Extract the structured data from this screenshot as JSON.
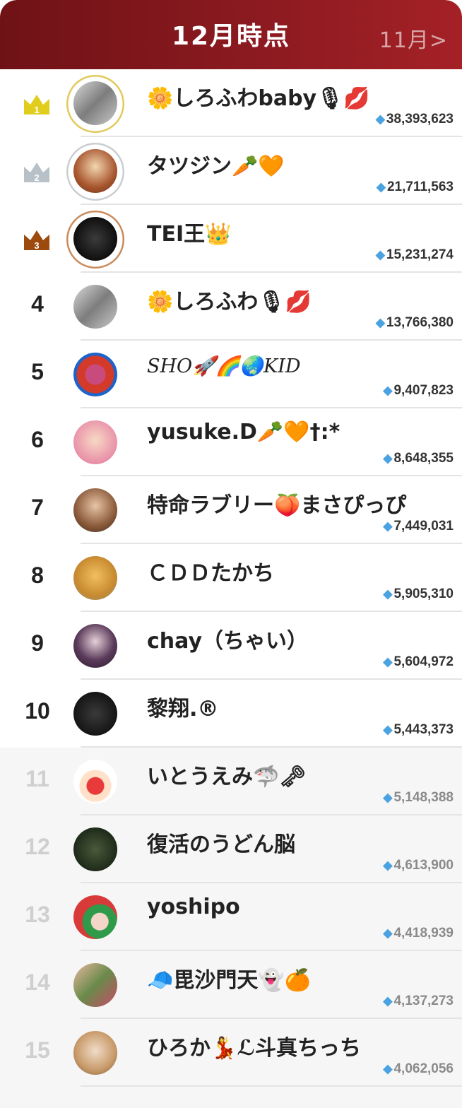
{
  "header": {
    "title": "12月時点",
    "next_month": "11月>"
  },
  "colors": {
    "header_start": "#6f1216",
    "header_end": "#a42126",
    "gold": "#e0cd1c",
    "silver": "#b8c0c8",
    "bronze": "#9c4a0e",
    "gem": "#4aa3e0"
  },
  "entries": [
    {
      "rank": "1",
      "name": "🌼しろふわbaby🎙💋",
      "score": "38,393,623",
      "crown": "gold"
    },
    {
      "rank": "2",
      "name": "タツジン🥕🧡",
      "score": "21,711,563",
      "crown": "silver"
    },
    {
      "rank": "3",
      "name": "TEI王👑",
      "score": "15,231,274",
      "crown": "bronze"
    },
    {
      "rank": "4",
      "name": "🌼しろふわ🎙💋",
      "score": "13,766,380"
    },
    {
      "rank": "5",
      "name": "SHO🚀🌈🌏KID",
      "score": "9,407,823"
    },
    {
      "rank": "6",
      "name": "yusuke.D🥕🧡†:*",
      "score": "8,648,355"
    },
    {
      "rank": "7",
      "name": "特命ラブリー🍑まさぴっぴ",
      "score": "7,449,031"
    },
    {
      "rank": "8",
      "name": "ＣＤＤたかち",
      "score": "5,905,310"
    },
    {
      "rank": "9",
      "name": "chay（ちゃい）",
      "score": "5,604,972"
    },
    {
      "rank": "10",
      "name": "黎翔.®",
      "score": "5,443,373"
    },
    {
      "rank": "11",
      "name": "いとうえみ🦈🗝",
      "score": "5,148,388"
    },
    {
      "rank": "12",
      "name": "復活のうどん脳",
      "score": "4,613,900"
    },
    {
      "rank": "13",
      "name": "yoshipo",
      "score": "4,418,939"
    },
    {
      "rank": "14",
      "name": "🧢毘沙門天👻🍊",
      "score": "4,137,273"
    },
    {
      "rank": "15",
      "name": "ひろか💃ℒ斗真ちっち",
      "score": "4,062,056"
    }
  ]
}
